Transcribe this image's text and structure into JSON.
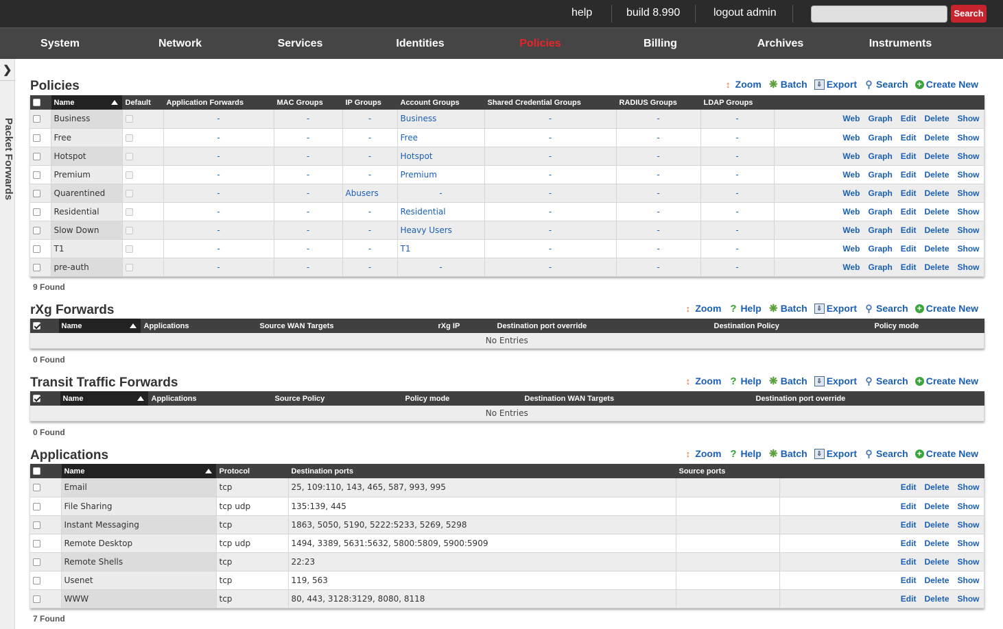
{
  "header": {
    "help": "help",
    "build": "build 8.990",
    "logout": "logout admin",
    "search_placeholder": "",
    "search_button": "Search"
  },
  "nav": [
    "System",
    "Network",
    "Services",
    "Identities",
    "Policies",
    "Billing",
    "Archives",
    "Instruments"
  ],
  "nav_active": "Policies",
  "sidebar": {
    "label": "Packet Forwards"
  },
  "tools": {
    "zoom": "Zoom",
    "help": "Help",
    "batch": "Batch",
    "export": "Export",
    "search": "Search",
    "create": "Create New"
  },
  "actions": {
    "web": "Web",
    "graph": "Graph",
    "edit": "Edit",
    "delete": "Delete",
    "show": "Show"
  },
  "policies": {
    "title": "Policies",
    "columns": [
      "Name",
      "Default",
      "Application Forwards",
      "MAC Groups",
      "IP Groups",
      "Account Groups",
      "Shared Credential Groups",
      "RADIUS Groups",
      "LDAP Groups"
    ],
    "rows": [
      {
        "name": "Business",
        "app": "-",
        "mac": "-",
        "ip": "-",
        "account": "Business",
        "shared": "-",
        "radius": "-",
        "ldap": "-"
      },
      {
        "name": "Free",
        "app": "-",
        "mac": "-",
        "ip": "-",
        "account": "Free",
        "shared": "-",
        "radius": "-",
        "ldap": "-"
      },
      {
        "name": "Hotspot",
        "app": "-",
        "mac": "-",
        "ip": "-",
        "account": "Hotspot",
        "shared": "-",
        "radius": "-",
        "ldap": "-"
      },
      {
        "name": "Premium",
        "app": "-",
        "mac": "-",
        "ip": "-",
        "account": "Premium",
        "shared": "-",
        "radius": "-",
        "ldap": "-"
      },
      {
        "name": "Quarentined",
        "app": "-",
        "mac": "-",
        "ip": "Abusers",
        "account": "-",
        "shared": "-",
        "radius": "-",
        "ldap": "-"
      },
      {
        "name": "Residential",
        "app": "-",
        "mac": "-",
        "ip": "-",
        "account": "Residential",
        "shared": "-",
        "radius": "-",
        "ldap": "-"
      },
      {
        "name": "Slow Down",
        "app": "-",
        "mac": "-",
        "ip": "-",
        "account": "Heavy Users",
        "shared": "-",
        "radius": "-",
        "ldap": "-"
      },
      {
        "name": "T1",
        "app": "-",
        "mac": "-",
        "ip": "-",
        "account": "T1",
        "shared": "-",
        "radius": "-",
        "ldap": "-"
      },
      {
        "name": "pre-auth",
        "app": "-",
        "mac": "-",
        "ip": "-",
        "account": "-",
        "shared": "-",
        "radius": "-",
        "ldap": "-"
      }
    ],
    "found": "9 Found"
  },
  "rxg": {
    "title": "rXg Forwards",
    "columns": [
      "Name",
      "Applications",
      "Source WAN Targets",
      "rXg IP",
      "Destination port override",
      "Destination Policy",
      "Policy mode"
    ],
    "empty": "No Entries",
    "found": "0 Found"
  },
  "transit": {
    "title": "Transit Traffic Forwards",
    "columns": [
      "Name",
      "Applications",
      "Source Policy",
      "Policy mode",
      "Destination WAN Targets",
      "Destination port override"
    ],
    "empty": "No Entries",
    "found": "0 Found"
  },
  "applications": {
    "title": "Applications",
    "columns": [
      "Name",
      "Protocol",
      "Destination ports",
      "Source ports"
    ],
    "rows": [
      {
        "name": "Email",
        "protocol": "tcp",
        "dest": "25, 109:110, 143, 465, 587, 993, 995",
        "src": ""
      },
      {
        "name": "File Sharing",
        "protocol": "tcp udp",
        "dest": "135:139, 445",
        "src": ""
      },
      {
        "name": "Instant Messaging",
        "protocol": "tcp",
        "dest": "1863, 5050, 5190, 5222:5233, 5269, 5298",
        "src": ""
      },
      {
        "name": "Remote Desktop",
        "protocol": "tcp udp",
        "dest": "1494, 3389, 5631:5632, 5800:5809, 5900:5909",
        "src": ""
      },
      {
        "name": "Remote Shells",
        "protocol": "tcp",
        "dest": "22:23",
        "src": ""
      },
      {
        "name": "Usenet",
        "protocol": "tcp",
        "dest": "119, 563",
        "src": ""
      },
      {
        "name": "WWW",
        "protocol": "tcp",
        "dest": "80, 443, 3128:3129, 8080, 8118",
        "src": ""
      }
    ],
    "found": "7 Found"
  },
  "colors": {
    "topbar": "#2b2b2b",
    "nav": "#454545",
    "active_nav": "#e8242b",
    "link": "#1a5fb4",
    "search_button": "#c8242d"
  }
}
